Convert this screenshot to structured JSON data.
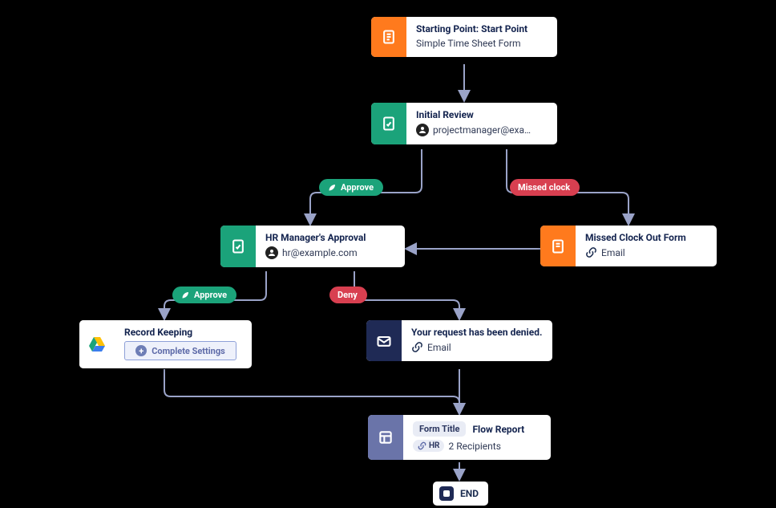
{
  "colors": {
    "orange": "#ff7a1d",
    "green": "#1ba37a",
    "navy": "#1f2a55",
    "purple": "#6a74a9",
    "red": "#d83f50"
  },
  "nodes": {
    "start": {
      "title": "Starting Point: Start Point",
      "subtitle": "Simple Time Sheet Form"
    },
    "initial_review": {
      "title": "Initial Review",
      "assignee": "projectmanager@exa…"
    },
    "hr_approval": {
      "title": "HR Manager's Approval",
      "assignee": "hr@example.com"
    },
    "missed_clock": {
      "title": "Missed Clock Out Form",
      "channel": "Email"
    },
    "record_keeping": {
      "title": "Record Keeping",
      "button": "Complete Settings"
    },
    "denied": {
      "title": "Your request has been denied.",
      "channel": "Email"
    },
    "final": {
      "title_label": "Form Title",
      "report_label": "Flow Report",
      "chip": "HR",
      "recipients_label": "2 Recipients"
    }
  },
  "pills": {
    "approve1": "Approve",
    "missed": "Missed clock",
    "approve2": "Approve",
    "deny": "Deny"
  },
  "end": {
    "label": "END"
  }
}
